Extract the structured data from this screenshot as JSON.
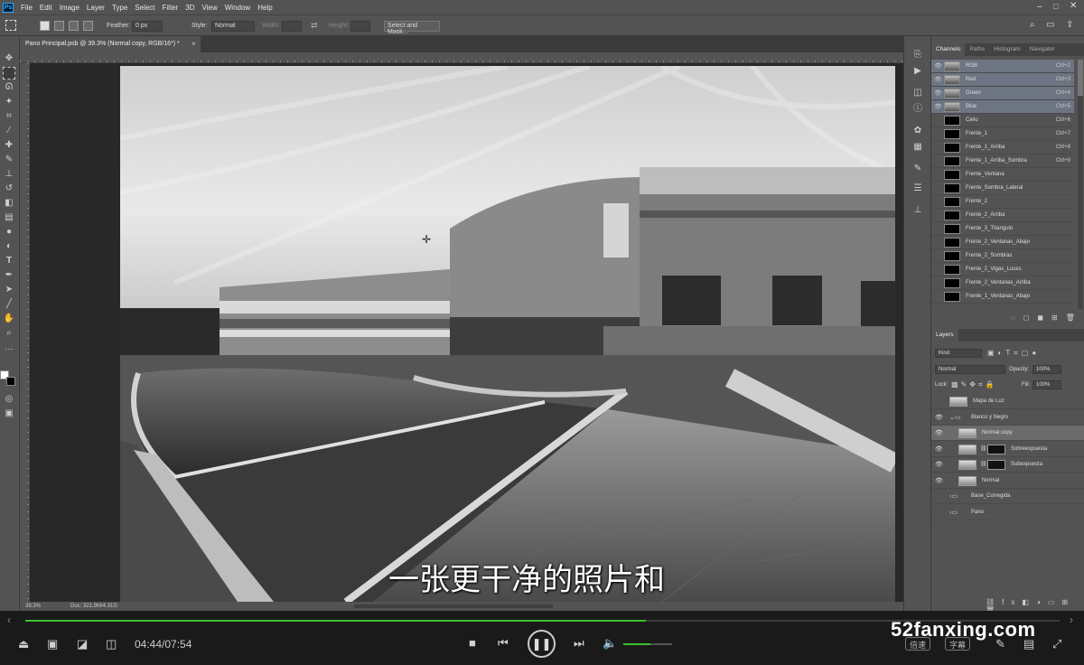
{
  "menu": [
    "File",
    "Edit",
    "Image",
    "Layer",
    "Type",
    "Select",
    "Filter",
    "3D",
    "View",
    "Window",
    "Help"
  ],
  "options": {
    "feather_label": "Feather:",
    "feather_value": "0 px",
    "style_label": "Style:",
    "style_value": "Normal",
    "width_label": "Width:",
    "height_label": "Height:",
    "select_mask": "Select and Mask..."
  },
  "document": {
    "tab_title": "Pano Principal.psb @ 39.3% (Normal copy, RGB/16*) *",
    "zoom": "39.3%",
    "doc_info": "Doc: 321.9M/4.31G"
  },
  "channels_panel": {
    "tabs": [
      "Channels",
      "Paths",
      "Histogram",
      "Navigator"
    ],
    "rows": [
      {
        "name": "RGB",
        "shortcut": "Ctrl+2",
        "visible": true,
        "selected": true
      },
      {
        "name": "Red",
        "shortcut": "Ctrl+3",
        "visible": true,
        "selected": true
      },
      {
        "name": "Green",
        "shortcut": "Ctrl+4",
        "visible": true,
        "selected": true
      },
      {
        "name": "Blue",
        "shortcut": "Ctrl+5",
        "visible": true,
        "selected": true
      },
      {
        "name": "Cielo",
        "shortcut": "Ctrl+6",
        "visible": false,
        "selected": false
      },
      {
        "name": "Frente_1",
        "shortcut": "Ctrl+7",
        "visible": false,
        "selected": false
      },
      {
        "name": "Frente_1_Arriba",
        "shortcut": "Ctrl+8",
        "visible": false,
        "selected": false
      },
      {
        "name": "Frente_1_Arriba_Sombra",
        "shortcut": "Ctrl+9",
        "visible": false,
        "selected": false
      },
      {
        "name": "Frente_Ventana",
        "shortcut": "",
        "visible": false,
        "selected": false
      },
      {
        "name": "Frente_Sombra_Lateral",
        "shortcut": "",
        "visible": false,
        "selected": false
      },
      {
        "name": "Frente_2",
        "shortcut": "",
        "visible": false,
        "selected": false
      },
      {
        "name": "Frente_2_Arriba",
        "shortcut": "",
        "visible": false,
        "selected": false
      },
      {
        "name": "Frente_3_Triangulo",
        "shortcut": "",
        "visible": false,
        "selected": false
      },
      {
        "name": "Frente_2_Ventanas_Abajo",
        "shortcut": "",
        "visible": false,
        "selected": false
      },
      {
        "name": "Frente_2_Sombras",
        "shortcut": "",
        "visible": false,
        "selected": false
      },
      {
        "name": "Frente_2_Vigas_Luces",
        "shortcut": "",
        "visible": false,
        "selected": false
      },
      {
        "name": "Frente_2_Ventanas_Arriba",
        "shortcut": "",
        "visible": false,
        "selected": false
      },
      {
        "name": "Frente_1_Ventanas_Abajo",
        "shortcut": "",
        "visible": false,
        "selected": false
      }
    ]
  },
  "layers_panel": {
    "title": "Layers",
    "filter": "Kind",
    "blend_mode": "Normal",
    "opacity_label": "Opacity:",
    "opacity_value": "100%",
    "lock_label": "Lock:",
    "fill_label": "Fill:",
    "fill_value": "100%",
    "rows": [
      {
        "name": "Mapa de Luz",
        "visible": false,
        "indent": 0,
        "type": "layer"
      },
      {
        "name": "Blanco y Negro",
        "visible": true,
        "indent": 0,
        "type": "group"
      },
      {
        "name": "Normal copy",
        "visible": true,
        "indent": 1,
        "type": "layer",
        "selected": true
      },
      {
        "name": "Sobreexpuesta",
        "visible": true,
        "indent": 1,
        "type": "masked"
      },
      {
        "name": "Subexpuesta",
        "visible": true,
        "indent": 1,
        "type": "masked"
      },
      {
        "name": "Normal",
        "visible": true,
        "indent": 1,
        "type": "layer"
      },
      {
        "name": "Base_Corregida",
        "visible": false,
        "indent": 0,
        "type": "group"
      },
      {
        "name": "Pano",
        "visible": false,
        "indent": 0,
        "type": "group"
      }
    ]
  },
  "player": {
    "timecode": "04:44/07:54",
    "progress": 0.6,
    "volume": 0.55,
    "speed_label": "倍速",
    "subtitle_label": "字幕"
  },
  "subtitle_text": "一张更干净的照片和",
  "watermark": "52fanxing.com"
}
